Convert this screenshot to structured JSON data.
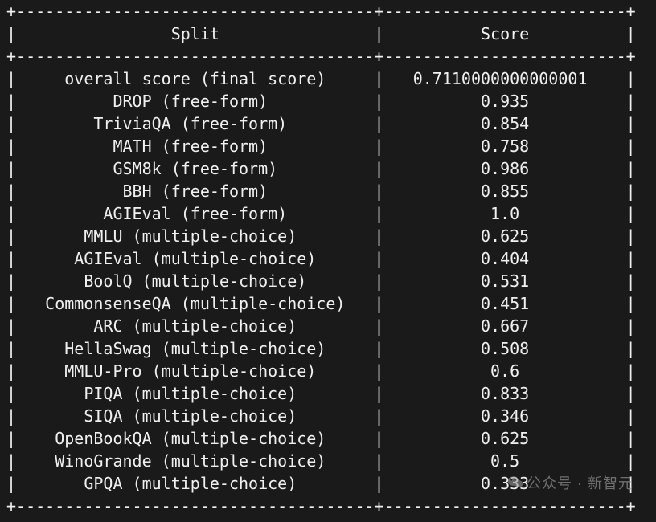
{
  "chart_data": {
    "type": "table",
    "title": "",
    "columns": [
      "Split",
      "Score"
    ],
    "rows": [
      {
        "split": "overall score (final score)",
        "score": "0.7110000000000001"
      },
      {
        "split": "DROP (free-form)",
        "score": "0.935"
      },
      {
        "split": "TriviaQA (free-form)",
        "score": "0.854"
      },
      {
        "split": "MATH (free-form)",
        "score": "0.758"
      },
      {
        "split": "GSM8k (free-form)",
        "score": "0.986"
      },
      {
        "split": "BBH (free-form)",
        "score": "0.855"
      },
      {
        "split": "AGIEval (free-form)",
        "score": "1.0"
      },
      {
        "split": "MMLU (multiple-choice)",
        "score": "0.625"
      },
      {
        "split": "AGIEval (multiple-choice)",
        "score": "0.404"
      },
      {
        "split": "BoolQ (multiple-choice)",
        "score": "0.531"
      },
      {
        "split": "CommonsenseQA (multiple-choice)",
        "score": "0.451"
      },
      {
        "split": "ARC (multiple-choice)",
        "score": "0.667"
      },
      {
        "split": "HellaSwag (multiple-choice)",
        "score": "0.508"
      },
      {
        "split": "MMLU-Pro (multiple-choice)",
        "score": "0.6"
      },
      {
        "split": "PIQA (multiple-choice)",
        "score": "0.833"
      },
      {
        "split": "SIQA (multiple-choice)",
        "score": "0.346"
      },
      {
        "split": "OpenBookQA (multiple-choice)",
        "score": "0.625"
      },
      {
        "split": "WinoGrande (multiple-choice)",
        "score": "0.5"
      },
      {
        "split": "GPQA (multiple-choice)",
        "score": "0.333"
      }
    ],
    "col_widths": {
      "split": 37,
      "score": 25
    }
  },
  "watermark": {
    "text": "公众号 · 新智元",
    "icon": "wechat-icon"
  }
}
